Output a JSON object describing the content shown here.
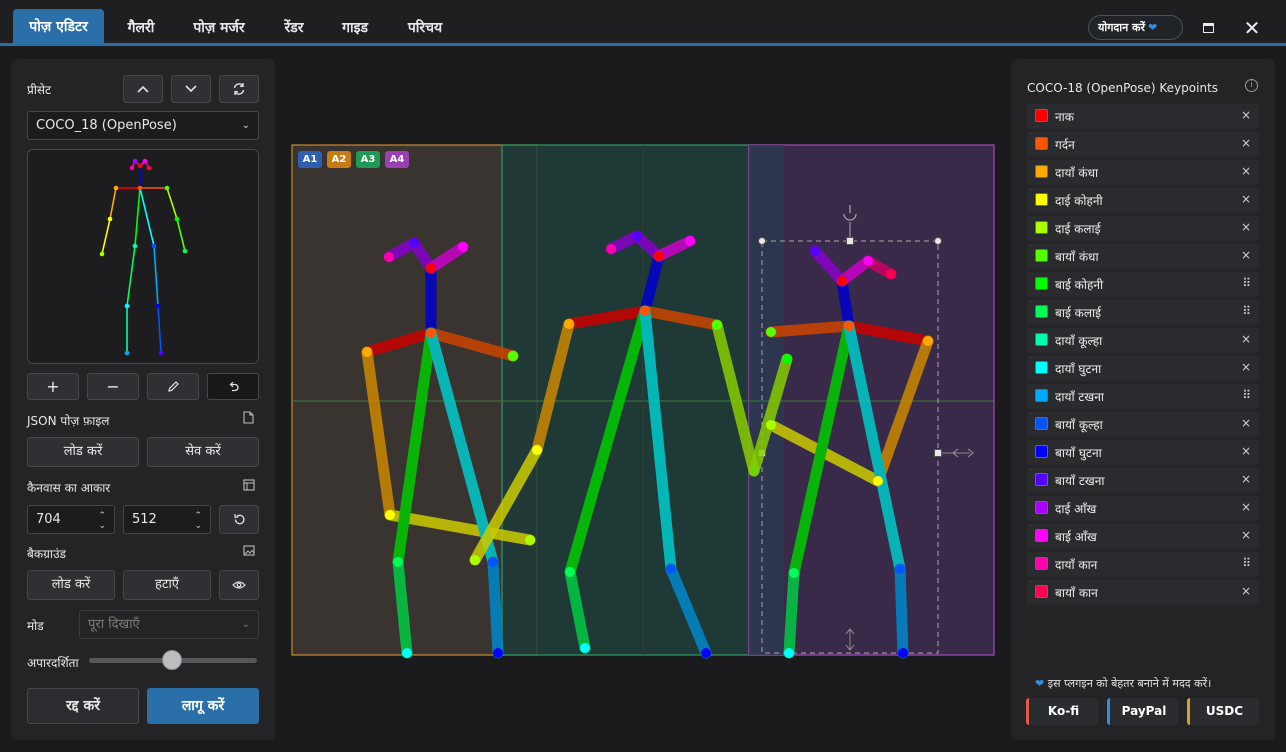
{
  "tabs": [
    {
      "label": "पोज़ एडिटर",
      "active": true
    },
    {
      "label": "गैलरी"
    },
    {
      "label": "पोज़ मर्जर"
    },
    {
      "label": "रेंडर"
    },
    {
      "label": "गाइड"
    },
    {
      "label": "परिचय"
    }
  ],
  "header": {
    "donate_label": "योगदान करें"
  },
  "left": {
    "preset_label": "प्रीसेट",
    "preset_value": "COCO_18 (OpenPose)",
    "json_label": "JSON पोज़ फ़ाइल",
    "load_label": "लोड करें",
    "save_label": "सेव करें",
    "canvas_size_label": "कैनवास का आकार",
    "width": "704",
    "height": "512",
    "background_label": "बैकग्राउंड",
    "bg_load_label": "लोड करें",
    "bg_remove_label": "हटाएँ",
    "mode_label": "मोड",
    "mode_placeholder": "पूरा दिखाएँ",
    "opacity_label": "अपारदर्शिता",
    "opacity_value": 0.5,
    "cancel_label": "रद्द करें",
    "apply_label": "लागू करें"
  },
  "canvas": {
    "badges": [
      {
        "label": "A1",
        "color": "#2f5fb0"
      },
      {
        "label": "A2",
        "color": "#c77c12"
      },
      {
        "label": "A3",
        "color": "#1e9a55"
      },
      {
        "label": "A4",
        "color": "#9b3fb5"
      }
    ]
  },
  "right": {
    "title": "COCO-18 (OpenPose) Keypoints",
    "keypoints": [
      {
        "name": "नाक",
        "color": "#ff0000",
        "action": "×"
      },
      {
        "name": "गर्दन",
        "color": "#ff5500",
        "action": "×"
      },
      {
        "name": "दायाँ कंधा",
        "color": "#ffaa00",
        "action": "×"
      },
      {
        "name": "दाई कोहनी",
        "color": "#ffff00",
        "action": "×"
      },
      {
        "name": "दाई कलाई",
        "color": "#aaff00",
        "action": "×"
      },
      {
        "name": "बायाँ कंधा",
        "color": "#55ff00",
        "action": "×"
      },
      {
        "name": "बाई कोहनी",
        "color": "#00ff00",
        "action": "⠿"
      },
      {
        "name": "बाई कलाई",
        "color": "#00ff55",
        "action": "⠿"
      },
      {
        "name": "दायाँ कूल्हा",
        "color": "#00ffaa",
        "action": "×"
      },
      {
        "name": "दायाँ घुटना",
        "color": "#00ffff",
        "action": "×"
      },
      {
        "name": "दायाँ टखना",
        "color": "#00aaff",
        "action": "⠿"
      },
      {
        "name": "बायाँ कूल्हा",
        "color": "#0055ff",
        "action": "×"
      },
      {
        "name": "बायाँ घुटना",
        "color": "#0000ff",
        "action": "×"
      },
      {
        "name": "बायाँ टखना",
        "color": "#5500ff",
        "action": "×"
      },
      {
        "name": "दाई आँख",
        "color": "#aa00ff",
        "action": "×"
      },
      {
        "name": "बाई आँख",
        "color": "#ff00ff",
        "action": "×"
      },
      {
        "name": "दायाँ कान",
        "color": "#ff00aa",
        "action": "⠿"
      },
      {
        "name": "बायाँ कान",
        "color": "#ff0055",
        "action": "×"
      }
    ],
    "help_text": "इस प्लगइन को बेहतर बनाने में मदद करें।",
    "donations": [
      {
        "label": "Ko-fi",
        "color": "#e05a4f"
      },
      {
        "label": "PayPal",
        "color": "#2c8fe3"
      },
      {
        "label": "USDC",
        "color": "#d6a231"
      }
    ]
  }
}
